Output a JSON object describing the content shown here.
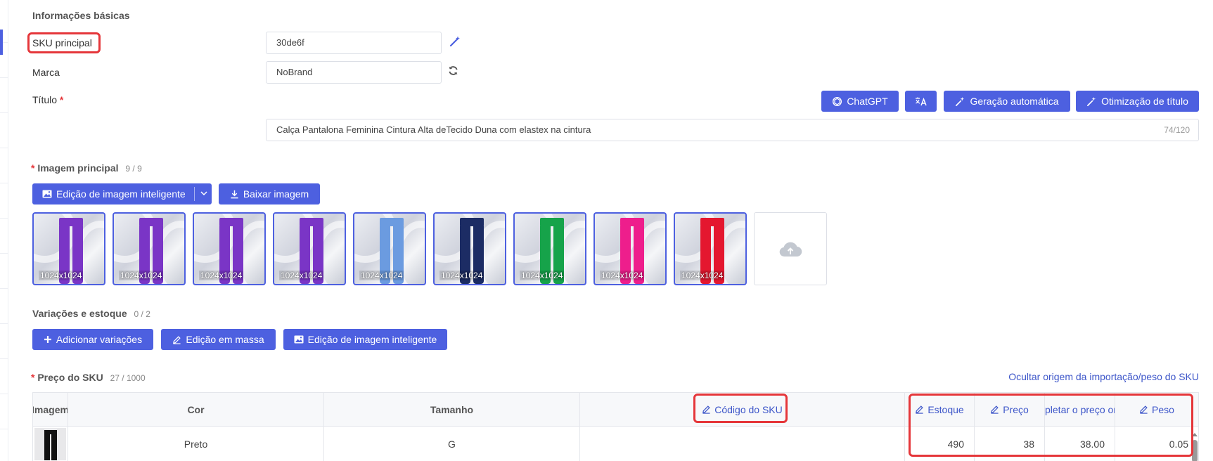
{
  "basic": {
    "section_title": "Informações básicas",
    "sku_label": "SKU principal",
    "sku_value": "30de6f",
    "brand_label": "Marca",
    "brand_value": "NoBrand",
    "title_label": "Título",
    "title_value": "Calça Pantalona Feminina Cintura Alta deTecido Duna com elastex na cintura",
    "title_counter": "74/120",
    "title_buttons": {
      "chatgpt": "ChatGPT",
      "auto_generation": "Geração automática",
      "title_optimization": "Otimização de título"
    }
  },
  "main_image": {
    "title": "Imagem principal",
    "counter": "9 / 9",
    "smart_edit_button": "Edição de imagem inteligente",
    "download_button": "Baixar imagem",
    "thumbnails": [
      {
        "size": "1024x1024",
        "color": "#7a35c6"
      },
      {
        "size": "1024x1024",
        "color": "#7a35c6"
      },
      {
        "size": "1024x1024",
        "color": "#7a35c6"
      },
      {
        "size": "1024x1024",
        "color": "#7a35c6"
      },
      {
        "size": "1024x1024",
        "color": "#6b9be0"
      },
      {
        "size": "1024x1024",
        "color": "#1c2c64"
      },
      {
        "size": "1024x1024",
        "color": "#16a34a"
      },
      {
        "size": "1024x1024",
        "color": "#ee1e8c"
      },
      {
        "size": "1024x1024",
        "color": "#e4172f"
      }
    ]
  },
  "variations": {
    "title": "Variações e estoque",
    "counter": "0 / 2",
    "add_button": "Adicionar variações",
    "bulk_edit_button": "Edição em massa",
    "smart_image_button": "Edição de imagem inteligente"
  },
  "sku_price": {
    "title": "Preço do SKU",
    "counter": "27 / 1000",
    "hide_link": "Ocultar origem da importação/peso do SKU",
    "columns": {
      "image": "Imagem",
      "color": "Cor",
      "size": "Tamanho",
      "sku_code": "Código do SKU",
      "stock": "Estoque",
      "price": "Preço",
      "complete_price": "pletar o preço or",
      "weight": "Peso"
    },
    "rows": [
      {
        "color": "Preto",
        "size": "G",
        "sku_code": "",
        "stock": "490",
        "price": "38",
        "complete_price": "38.00",
        "weight": "0.05"
      }
    ]
  },
  "accent_color": "#4d60e0",
  "highlight_color": "#e5363a"
}
